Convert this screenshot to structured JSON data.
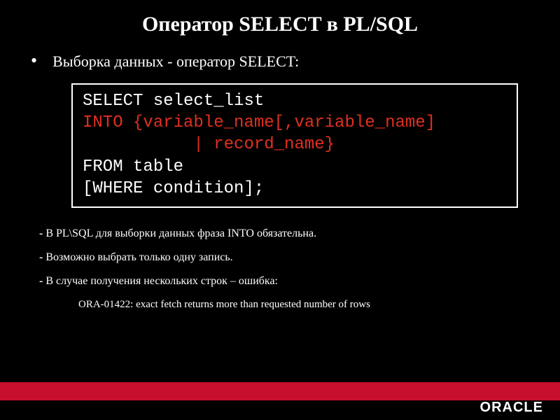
{
  "title": "Оператор SELECT в PL/SQL",
  "subtitle": "Выборка данных  - оператор SELECT:",
  "code": {
    "l1a": "SELECT",
    "l1b": " select_list",
    "l2a": "INTO {variable_name[,variable_name]",
    "l3a": "           | record_name}",
    "l4a": "FROM",
    "l4b": " table",
    "l5a": "[WHERE",
    "l5b": " condition];"
  },
  "notes": {
    "n1": "В PL\\SQL для выборки данных фраза INTO обязательна.",
    "n2": "Возможно выбрать только одну запись.",
    "n3": "В случае получения нескольких строк – ошибка:",
    "ora": "ORA-01422: exact fetch returns more than requested number of rows"
  },
  "dash": "- ",
  "footer": {
    "brand": "ORACLE"
  }
}
